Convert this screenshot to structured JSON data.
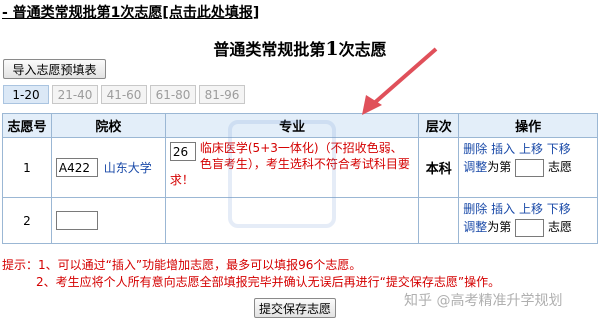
{
  "header": {
    "link_text": "- 普通类常规批第1次志愿[点击此处填报]",
    "title_prefix": "普通类常规批第",
    "title_num": "1",
    "title_suffix": "次志愿"
  },
  "toolbar": {
    "import_label": "导入志愿预填表"
  },
  "tabs": [
    {
      "label": "1-20",
      "active": true
    },
    {
      "label": "21-40"
    },
    {
      "label": "41-60"
    },
    {
      "label": "61-80"
    },
    {
      "label": "81-96"
    }
  ],
  "table": {
    "headers": [
      "志愿号",
      "院校",
      "专业",
      "层次",
      "操作"
    ],
    "rows": [
      {
        "no": "1",
        "school_code": "A422",
        "school_name": "山东大学",
        "major_code": "26",
        "major_name": "临床医学(5+3一体化)（不招收色弱、色盲考生）",
        "major_warning": "，考生选科不符合考试科目要求！",
        "level": "本科",
        "ops": {
          "delete": "删除",
          "insert": "插入",
          "up": "上移",
          "down": "下移",
          "adjust": "调整",
          "to": "为第",
          "unit": "志愿"
        }
      },
      {
        "no": "2",
        "school_code": "",
        "ops": {
          "delete": "删除",
          "insert": "插入",
          "up": "上移",
          "down": "下移",
          "adjust": "调整",
          "to": "为第",
          "unit": "志愿"
        }
      }
    ]
  },
  "tips": {
    "line1": "提示：1、可以通过“插入”功能增加志愿，最多可以填报96个志愿。",
    "line2": "2、考生应将个人所有意向志愿全部填报完毕并确认无误后再进行“提交保存志愿”操作。"
  },
  "submit_label": "提交保存志愿",
  "watermark": "知乎 @高考精准升学规划",
  "colors": {
    "header_bg": "#e3eef9",
    "border": "#9bb7d4",
    "link": "#1a4aa8",
    "warning": "#d40000",
    "arrow": "#e0505a"
  }
}
